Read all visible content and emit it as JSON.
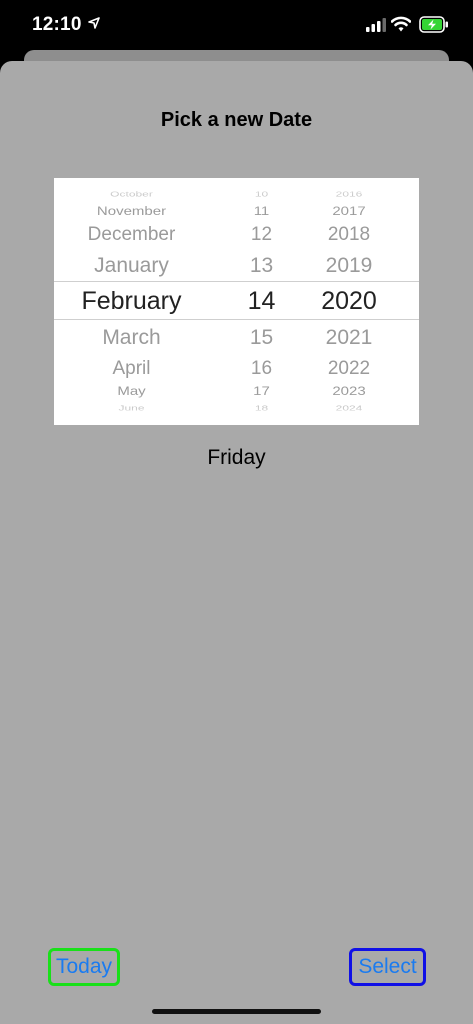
{
  "status_bar": {
    "time": "12:10",
    "icons": [
      "location-arrow-icon",
      "cellular-signal-icon",
      "wifi-icon",
      "battery-charging-icon"
    ]
  },
  "sheet": {
    "title": "Pick a new Date",
    "weekday": "Friday"
  },
  "picker": {
    "month": {
      "items": [
        "October",
        "November",
        "December",
        "January",
        "February",
        "March",
        "April",
        "May",
        "June"
      ],
      "selected": "February"
    },
    "day": {
      "items": [
        "10",
        "11",
        "12",
        "13",
        "14",
        "15",
        "16",
        "17",
        "18"
      ],
      "selected": "14"
    },
    "year": {
      "items": [
        "2016",
        "2017",
        "2018",
        "2019",
        "2020",
        "2021",
        "2022",
        "2023",
        "2024"
      ],
      "selected": "2020"
    }
  },
  "buttons": {
    "today": "Today",
    "select": "Select"
  },
  "colors": {
    "sheet_background": "#a9a9a9",
    "button_text": "#1a7bf0",
    "today_border": "#19e019",
    "select_border": "#1010e6"
  }
}
